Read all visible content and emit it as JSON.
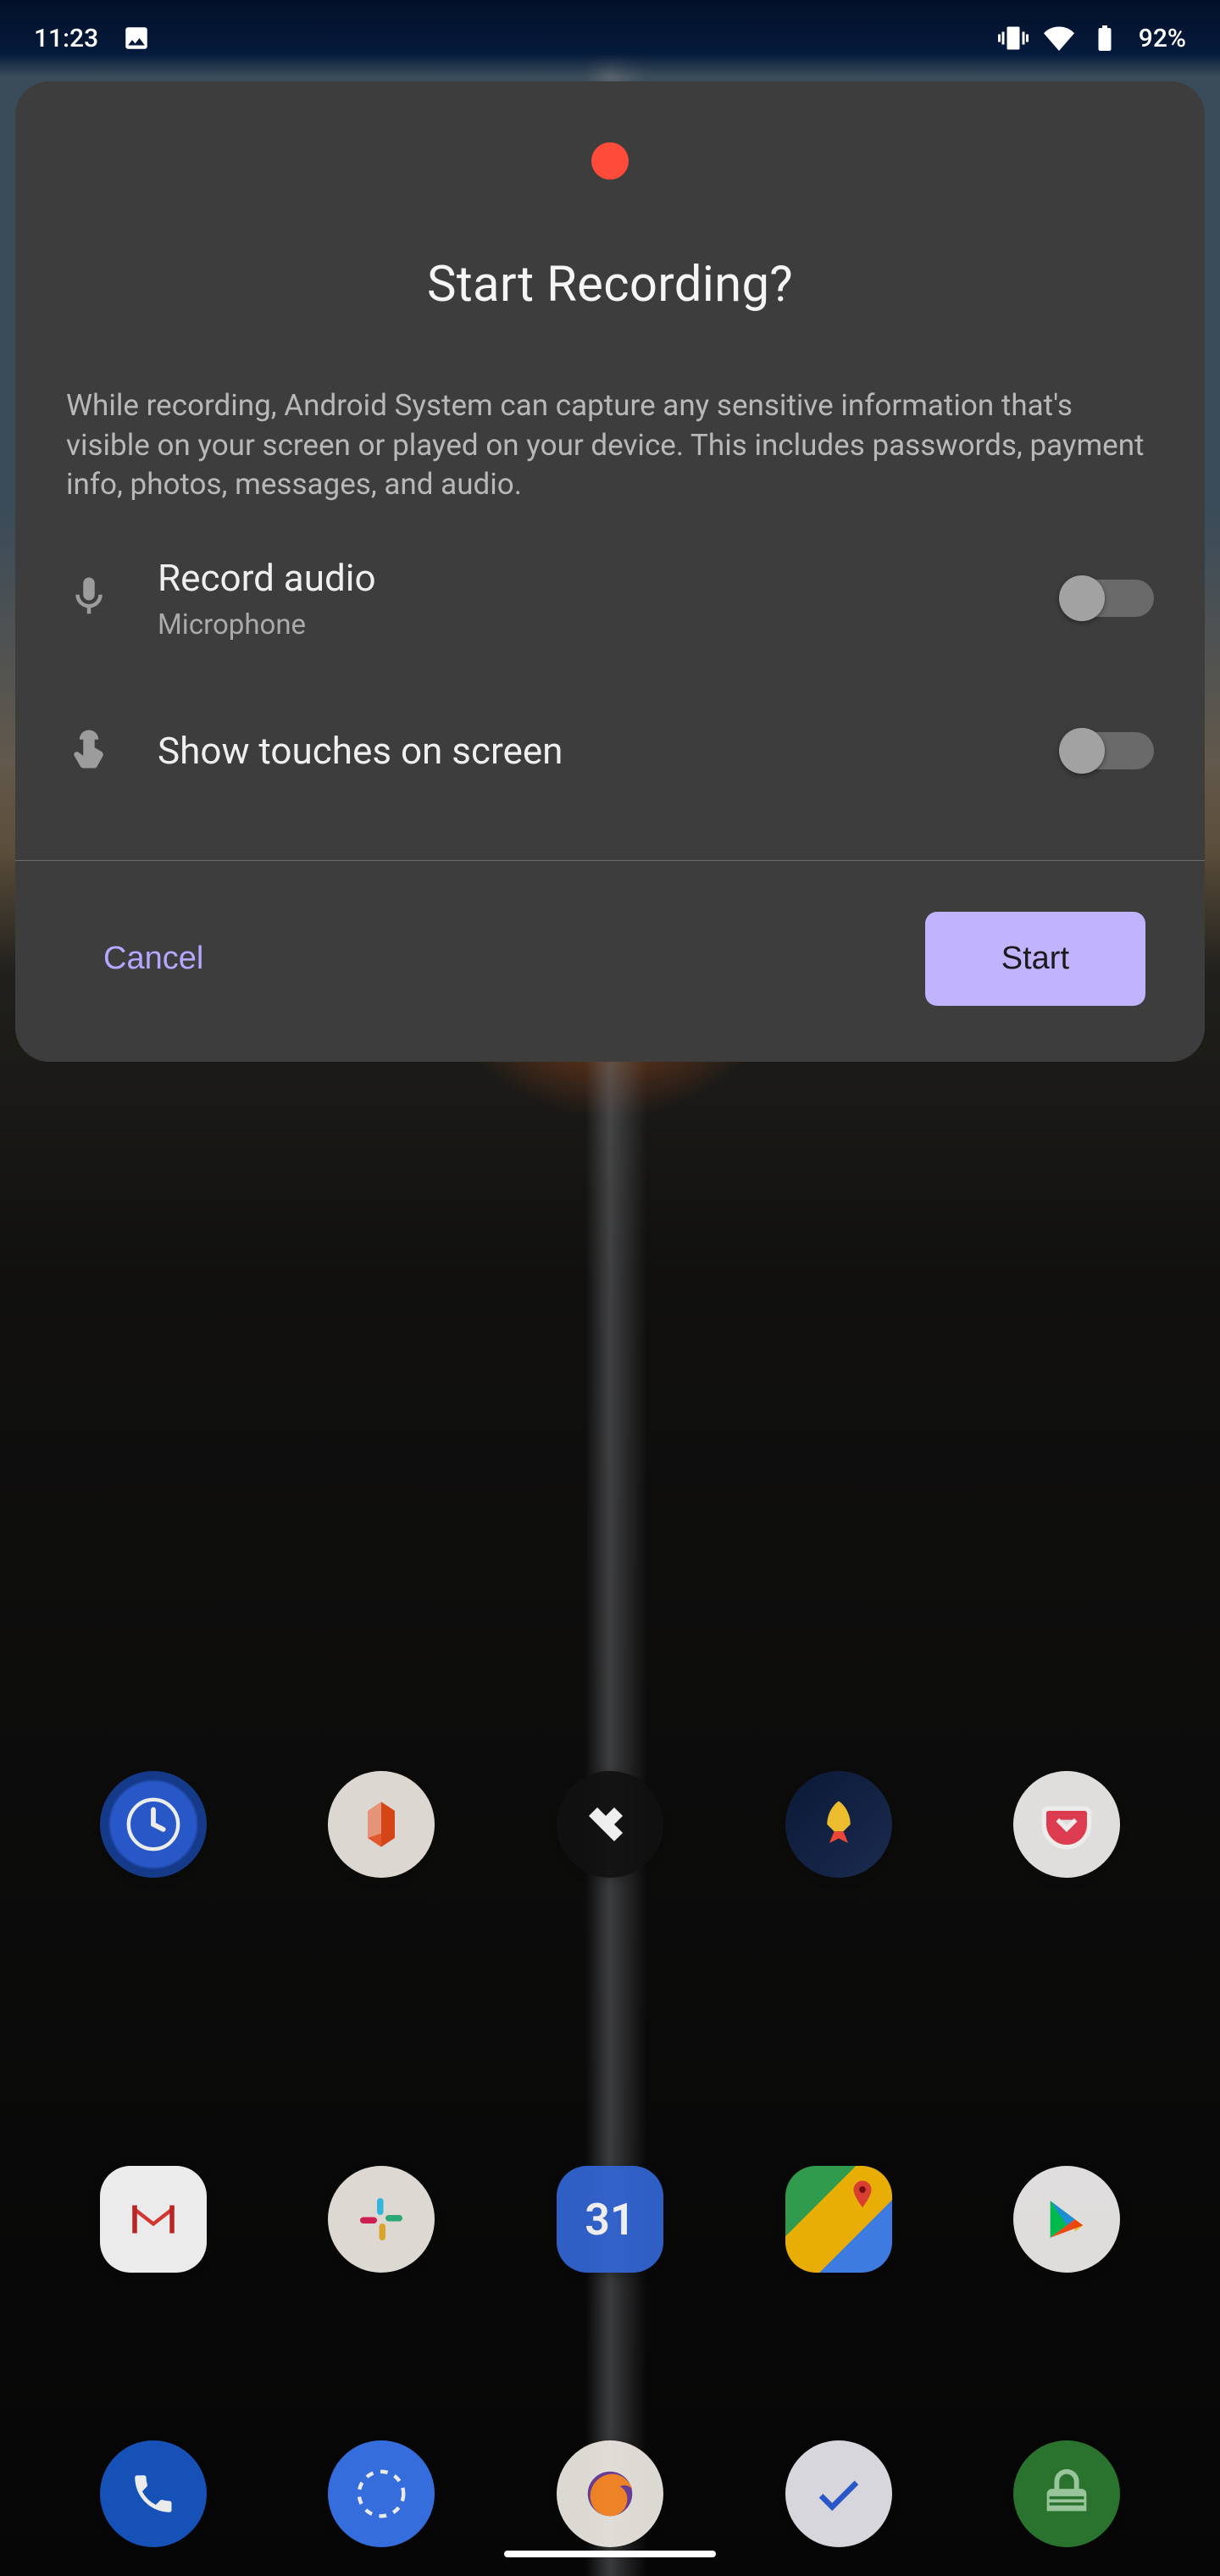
{
  "status_bar": {
    "time": "11:23",
    "battery": "92%",
    "icons": [
      "image-icon",
      "vibrate-icon",
      "wifi-icon",
      "battery-icon"
    ]
  },
  "dialog": {
    "title": "Start Recording?",
    "body": "While recording, Android System can capture any sensitive information that's visible on your screen or played on your device. This includes passwords, payment info, photos, messages, and audio.",
    "options": {
      "record_audio": {
        "title": "Record audio",
        "subtitle": "Microphone",
        "enabled": false
      },
      "show_touches": {
        "title": "Show touches on screen",
        "enabled": false
      }
    },
    "cancel_label": "Cancel",
    "start_label": "Start"
  },
  "home_icons": {
    "row1": [
      "Clock",
      "Office",
      "Tidal",
      "Rocket",
      "Pocket"
    ],
    "row2": [
      "Gmail",
      "Slack",
      "Calendar",
      "Maps",
      "Play Store"
    ],
    "row3": [
      "Phone",
      "Signal",
      "Firefox",
      "Tasks",
      "Screen Lock"
    ]
  },
  "colors": {
    "dialog_bg": "#3d3d3d",
    "rec_dot": "#ff4b3a",
    "accent_text": "#b6a6ff",
    "accent_fill": "#c2b3ff"
  }
}
